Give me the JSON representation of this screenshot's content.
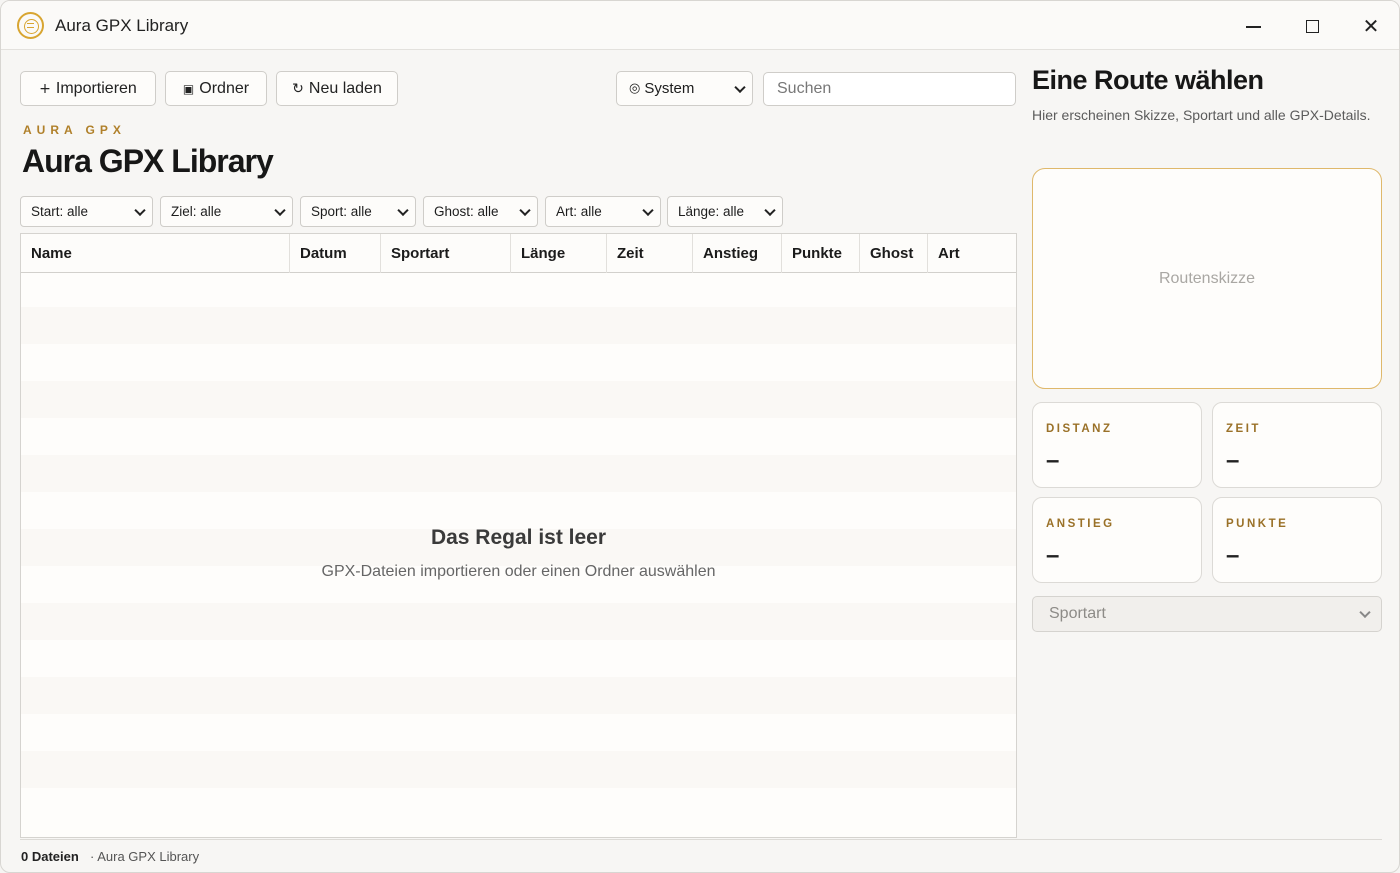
{
  "window": {
    "title": "Aura GPX Library"
  },
  "toolbar": {
    "import_label": "Importieren",
    "import_icon": "+",
    "folder_label": "Ordner",
    "folder_icon": "▣",
    "reload_label": "Neu laden",
    "reload_icon": "↻",
    "theme_icon": "◎",
    "theme_value": "System",
    "search_placeholder": "Suchen"
  },
  "header": {
    "eyebrow": "AURA GPX",
    "title": "Aura GPX Library"
  },
  "filters": [
    "Start: alle",
    "Ziel: alle",
    "Sport: alle",
    "Ghost: alle",
    "Art: alle",
    "Länge: alle"
  ],
  "table": {
    "columns": [
      "Name",
      "Datum",
      "Sportart",
      "Länge",
      "Zeit",
      "Anstieg",
      "Punkte",
      "Ghost",
      "Art"
    ],
    "rows": [],
    "empty_title": "Das Regal ist leer",
    "empty_subtitle": "GPX-Dateien importieren oder einen Ordner auswählen"
  },
  "status": {
    "count": "0 Dateien",
    "app": "· Aura GPX Library"
  },
  "detail": {
    "title": "Eine Route wählen",
    "subtitle": "Hier erscheinen Skizze, Sportart und alle GPX-Details.",
    "sketch_placeholder": "Routenskizze",
    "stats": [
      {
        "label": "DISTANZ",
        "value": "–"
      },
      {
        "label": "ZEIT",
        "value": "–"
      },
      {
        "label": "ANSTIEG",
        "value": "–"
      },
      {
        "label": "PUNKTE",
        "value": "–"
      }
    ],
    "sport_placeholder": "Sportart"
  },
  "colors": {
    "accent": "#d8a531",
    "label": "#9a7128"
  }
}
